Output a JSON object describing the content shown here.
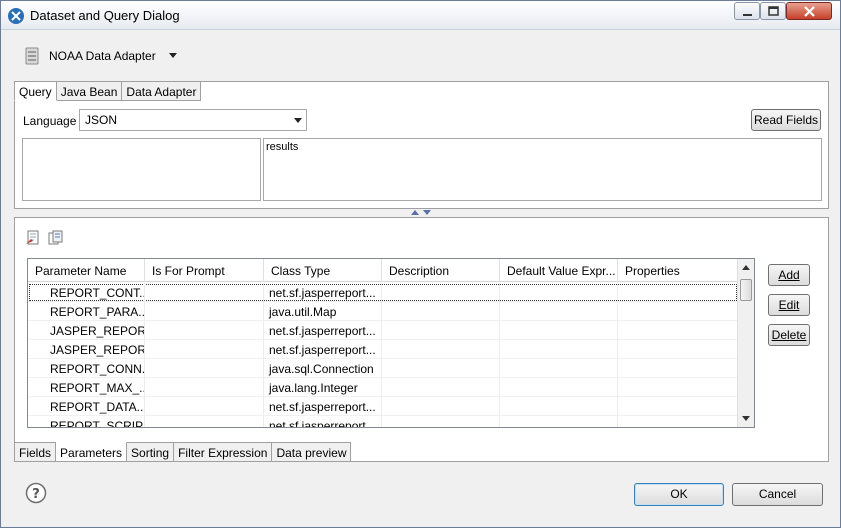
{
  "window": {
    "title": "Dataset and Query Dialog",
    "icons": [
      "app-icon",
      "minimize-icon",
      "maximize-icon",
      "close-icon"
    ]
  },
  "adapter": {
    "label": "NOAA Data Adapter",
    "icon": "database-icon"
  },
  "query": {
    "tabs": [
      "Query",
      "Java Bean",
      "Data Adapter"
    ],
    "active_tab": "Query",
    "language_label": "Language",
    "language_value": "JSON",
    "read_fields_label": "Read Fields",
    "query_text": "results"
  },
  "params": {
    "tool_icons": [
      "new-parameter-icon",
      "copy-parameter-icon"
    ],
    "columns": [
      "Parameter Name",
      "Is For Prompt",
      "Class Type",
      "Description",
      "Default Value Expr...",
      "Properties"
    ],
    "rows": [
      [
        "REPORT_CONT...",
        "",
        "net.sf.jasperreport...",
        "",
        "",
        ""
      ],
      [
        "REPORT_PARA...",
        "",
        "java.util.Map",
        "",
        "",
        ""
      ],
      [
        "JASPER_REPOR...",
        "",
        "net.sf.jasperreport...",
        "",
        "",
        ""
      ],
      [
        "JASPER_REPORT",
        "",
        "net.sf.jasperreport...",
        "",
        "",
        ""
      ],
      [
        "REPORT_CONN...",
        "",
        "java.sql.Connection",
        "",
        "",
        ""
      ],
      [
        "REPORT_MAX_...",
        "",
        "java.lang.Integer",
        "",
        "",
        ""
      ],
      [
        "REPORT_DATA...",
        "",
        "net.sf.jasperreport...",
        "",
        "",
        ""
      ],
      [
        "REPORT_SCRIP...",
        "",
        "net.sf.jasperreport...",
        "",
        "",
        ""
      ]
    ],
    "add_label": "Add",
    "edit_label": "Edit",
    "delete_label": "Delete",
    "bottom_tabs": [
      "Fields",
      "Parameters",
      "Sorting",
      "Filter Expression",
      "Data preview"
    ],
    "active_bottom_tab": "Parameters"
  },
  "footer": {
    "help_icon": "help-icon",
    "ok_label": "OK",
    "cancel_label": "Cancel"
  },
  "colors": {
    "accent": "#3c7fb1",
    "close_button": "#c7402a"
  }
}
